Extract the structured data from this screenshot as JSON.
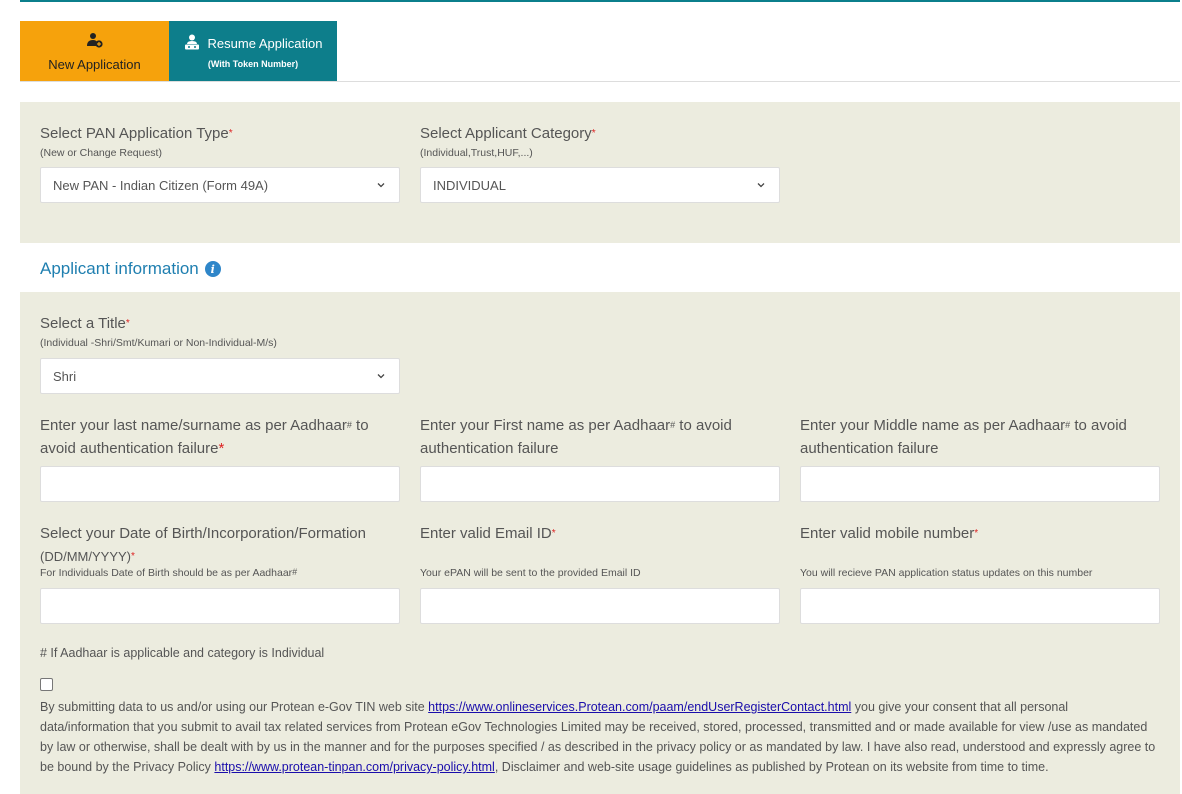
{
  "tabs": {
    "new_application": {
      "label": "New Application",
      "icon": "add-user-icon"
    },
    "resume_application": {
      "label": "Resume Application",
      "sub_label": "(With Token Number)",
      "icon": "person-desk-icon"
    }
  },
  "application_type": {
    "label": "Select PAN Application Type",
    "required_mark": "*",
    "hint": "(New or Change Request)",
    "selected": "New PAN - Indian Citizen (Form 49A)"
  },
  "applicant_category": {
    "label": "Select Applicant Category",
    "required_mark": "*",
    "hint": "(Individual,Trust,HUF,...)",
    "selected": "INDIVIDUAL"
  },
  "section": {
    "title": "Applicant information",
    "info_icon": "info-icon"
  },
  "title_field": {
    "label": "Select a Title",
    "required_mark": "*",
    "hint": "(Individual -Shri/Smt/Kumari or Non-Individual-M/s)",
    "selected": "Shri"
  },
  "last_name": {
    "label_1": "Enter your last name/surname as per Aadhaar",
    "hash": "#",
    "label_2": " to",
    "label_3": "avoid authentication failure",
    "required_mark": "*",
    "value": ""
  },
  "first_name": {
    "label_1": "Enter your First name as per Aadhaar",
    "hash": "#",
    "label_2": " to avoid",
    "label_3": "authentication failure",
    "value": ""
  },
  "middle_name": {
    "label_1": "Enter your Middle name as per Aadhaar",
    "hash": "#",
    "label_2": " to avoid",
    "label_3": "authentication failure",
    "value": ""
  },
  "dob": {
    "label_1": "Select your Date of Birth/Incorporation/Formation",
    "label_2": "(DD/MM/YYYY)",
    "required_mark": "*",
    "hint": "For Individuals Date of Birth should be as per Aadhaar",
    "hint_hash": "#",
    "value": ""
  },
  "email": {
    "label": "Enter valid Email ID",
    "required_mark": "*",
    "hint": "Your ePAN will be sent to the provided Email ID",
    "value": ""
  },
  "mobile": {
    "label": "Enter valid mobile number",
    "required_mark": "*",
    "hint": "You will recieve PAN application status updates on this number",
    "value": ""
  },
  "aadhaar_note": "# If Aadhaar is applicable and category is Individual",
  "consent": {
    "checked": false,
    "text_1": "By submitting data to us and/or using our Protean e-Gov TIN web site ",
    "link_1": "https://www.onlineservices.Protean.com/paam/endUserRegisterContact.html",
    "text_2": " you give your consent that all personal data/information that you submit to avail tax related services from Protean eGov Technologies Limited may be received, stored, processed, transmitted and or made available for view /use as mandated by law or otherwise, shall be dealt with by us in the manner and for the purposes specified / as described in the privacy policy or as mandated by law. I have also read, understood and expressly agree to be bound by the Privacy Policy ",
    "link_2": "https://www.protean-tinpan.com/privacy-policy.html",
    "text_3": ", Disclaimer and web-site usage guidelines as published by Protean on its website from time to time."
  },
  "colors": {
    "accent_orange": "#f6a20c",
    "accent_teal": "#0d7e8b",
    "panel_bg": "#ececdf",
    "section_title": "#1f7fb0",
    "required": "#dd2222"
  }
}
